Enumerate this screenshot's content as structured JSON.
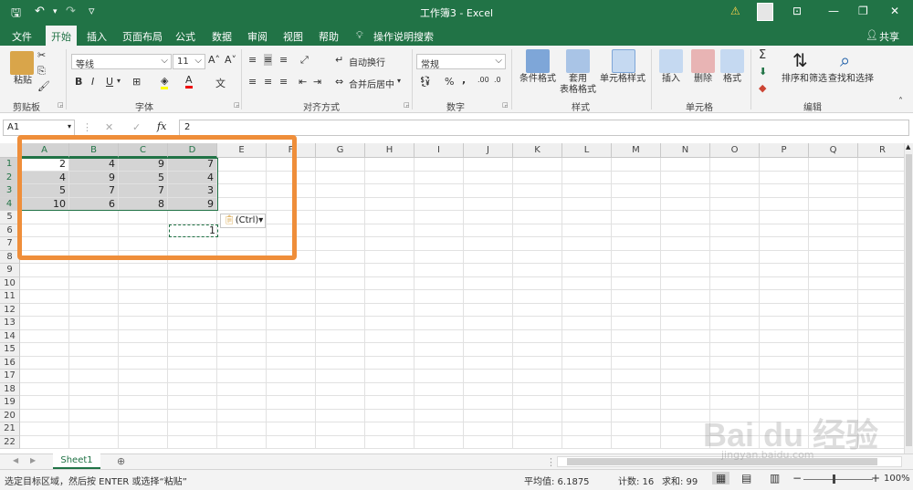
{
  "quick_access": {
    "save": "🖫",
    "undo": "↶",
    "redo": "↷",
    "more": "▿"
  },
  "window": {
    "title": "工作簿3 - Excel",
    "warning": "⚠",
    "ribbon_opts": "⊡",
    "minimize": "—",
    "restore": "❐",
    "close": "✕"
  },
  "tabs": [
    "文件",
    "开始",
    "插入",
    "页面布局",
    "公式",
    "数据",
    "审阅",
    "视图",
    "帮助"
  ],
  "active_tab": "开始",
  "tell_me": "操作说明搜索",
  "share": "共享",
  "ribbon": {
    "clipboard": {
      "paste": "粘贴",
      "label": "剪贴板"
    },
    "font": {
      "name": "等线",
      "size": "11",
      "grow": "A˄",
      "shrink": "A˅",
      "bold": "B",
      "italic": "I",
      "underline": "U",
      "label": "字体"
    },
    "align": {
      "wrap": "自动换行",
      "merge": "合并后居中",
      "label": "对齐方式"
    },
    "number": {
      "format": "常规",
      "percent": "%",
      "comma": ",",
      "label": "数字"
    },
    "styles": {
      "cond": "条件格式",
      "table": "套用\n表格格式",
      "cellstyle": "单元格样式",
      "label": "样式"
    },
    "cells": {
      "insert": "插入",
      "delete": "删除",
      "format": "格式",
      "label": "单元格"
    },
    "edit": {
      "sortfilter": "排序和筛选",
      "findselect": "查找和选择",
      "label": "编辑"
    }
  },
  "formula_bar": {
    "name_box": "A1",
    "cancel": "✕",
    "enter": "✓",
    "fx": "fx",
    "value": "2"
  },
  "columns": [
    "A",
    "B",
    "C",
    "D",
    "E",
    "F",
    "G",
    "H",
    "I",
    "J",
    "K",
    "L",
    "M",
    "N",
    "O",
    "P",
    "Q",
    "R"
  ],
  "rows": [
    "1",
    "2",
    "3",
    "4",
    "5",
    "6",
    "7",
    "8",
    "9",
    "10",
    "11",
    "12",
    "13",
    "14",
    "15",
    "16",
    "17",
    "18",
    "19",
    "20",
    "21",
    "22"
  ],
  "cells": [
    [
      "2",
      "4",
      "9",
      "7"
    ],
    [
      "4",
      "9",
      "5",
      "4"
    ],
    [
      "5",
      "7",
      "7",
      "3"
    ],
    [
      "10",
      "6",
      "8",
      "9"
    ]
  ],
  "d6": "1",
  "paste_options": "(Ctrl)▾",
  "sheet": {
    "tab": "Sheet1",
    "add": "⊕"
  },
  "status": {
    "message": "选定目标区域，然后按 ENTER 或选择“粘贴”",
    "average": "平均值: 6.1875",
    "count": "计数: 16",
    "sum": "求和: 99",
    "zoom": "100%"
  },
  "watermark": "Bai du 经验",
  "watermark_url": "jingyan.baidu.com"
}
